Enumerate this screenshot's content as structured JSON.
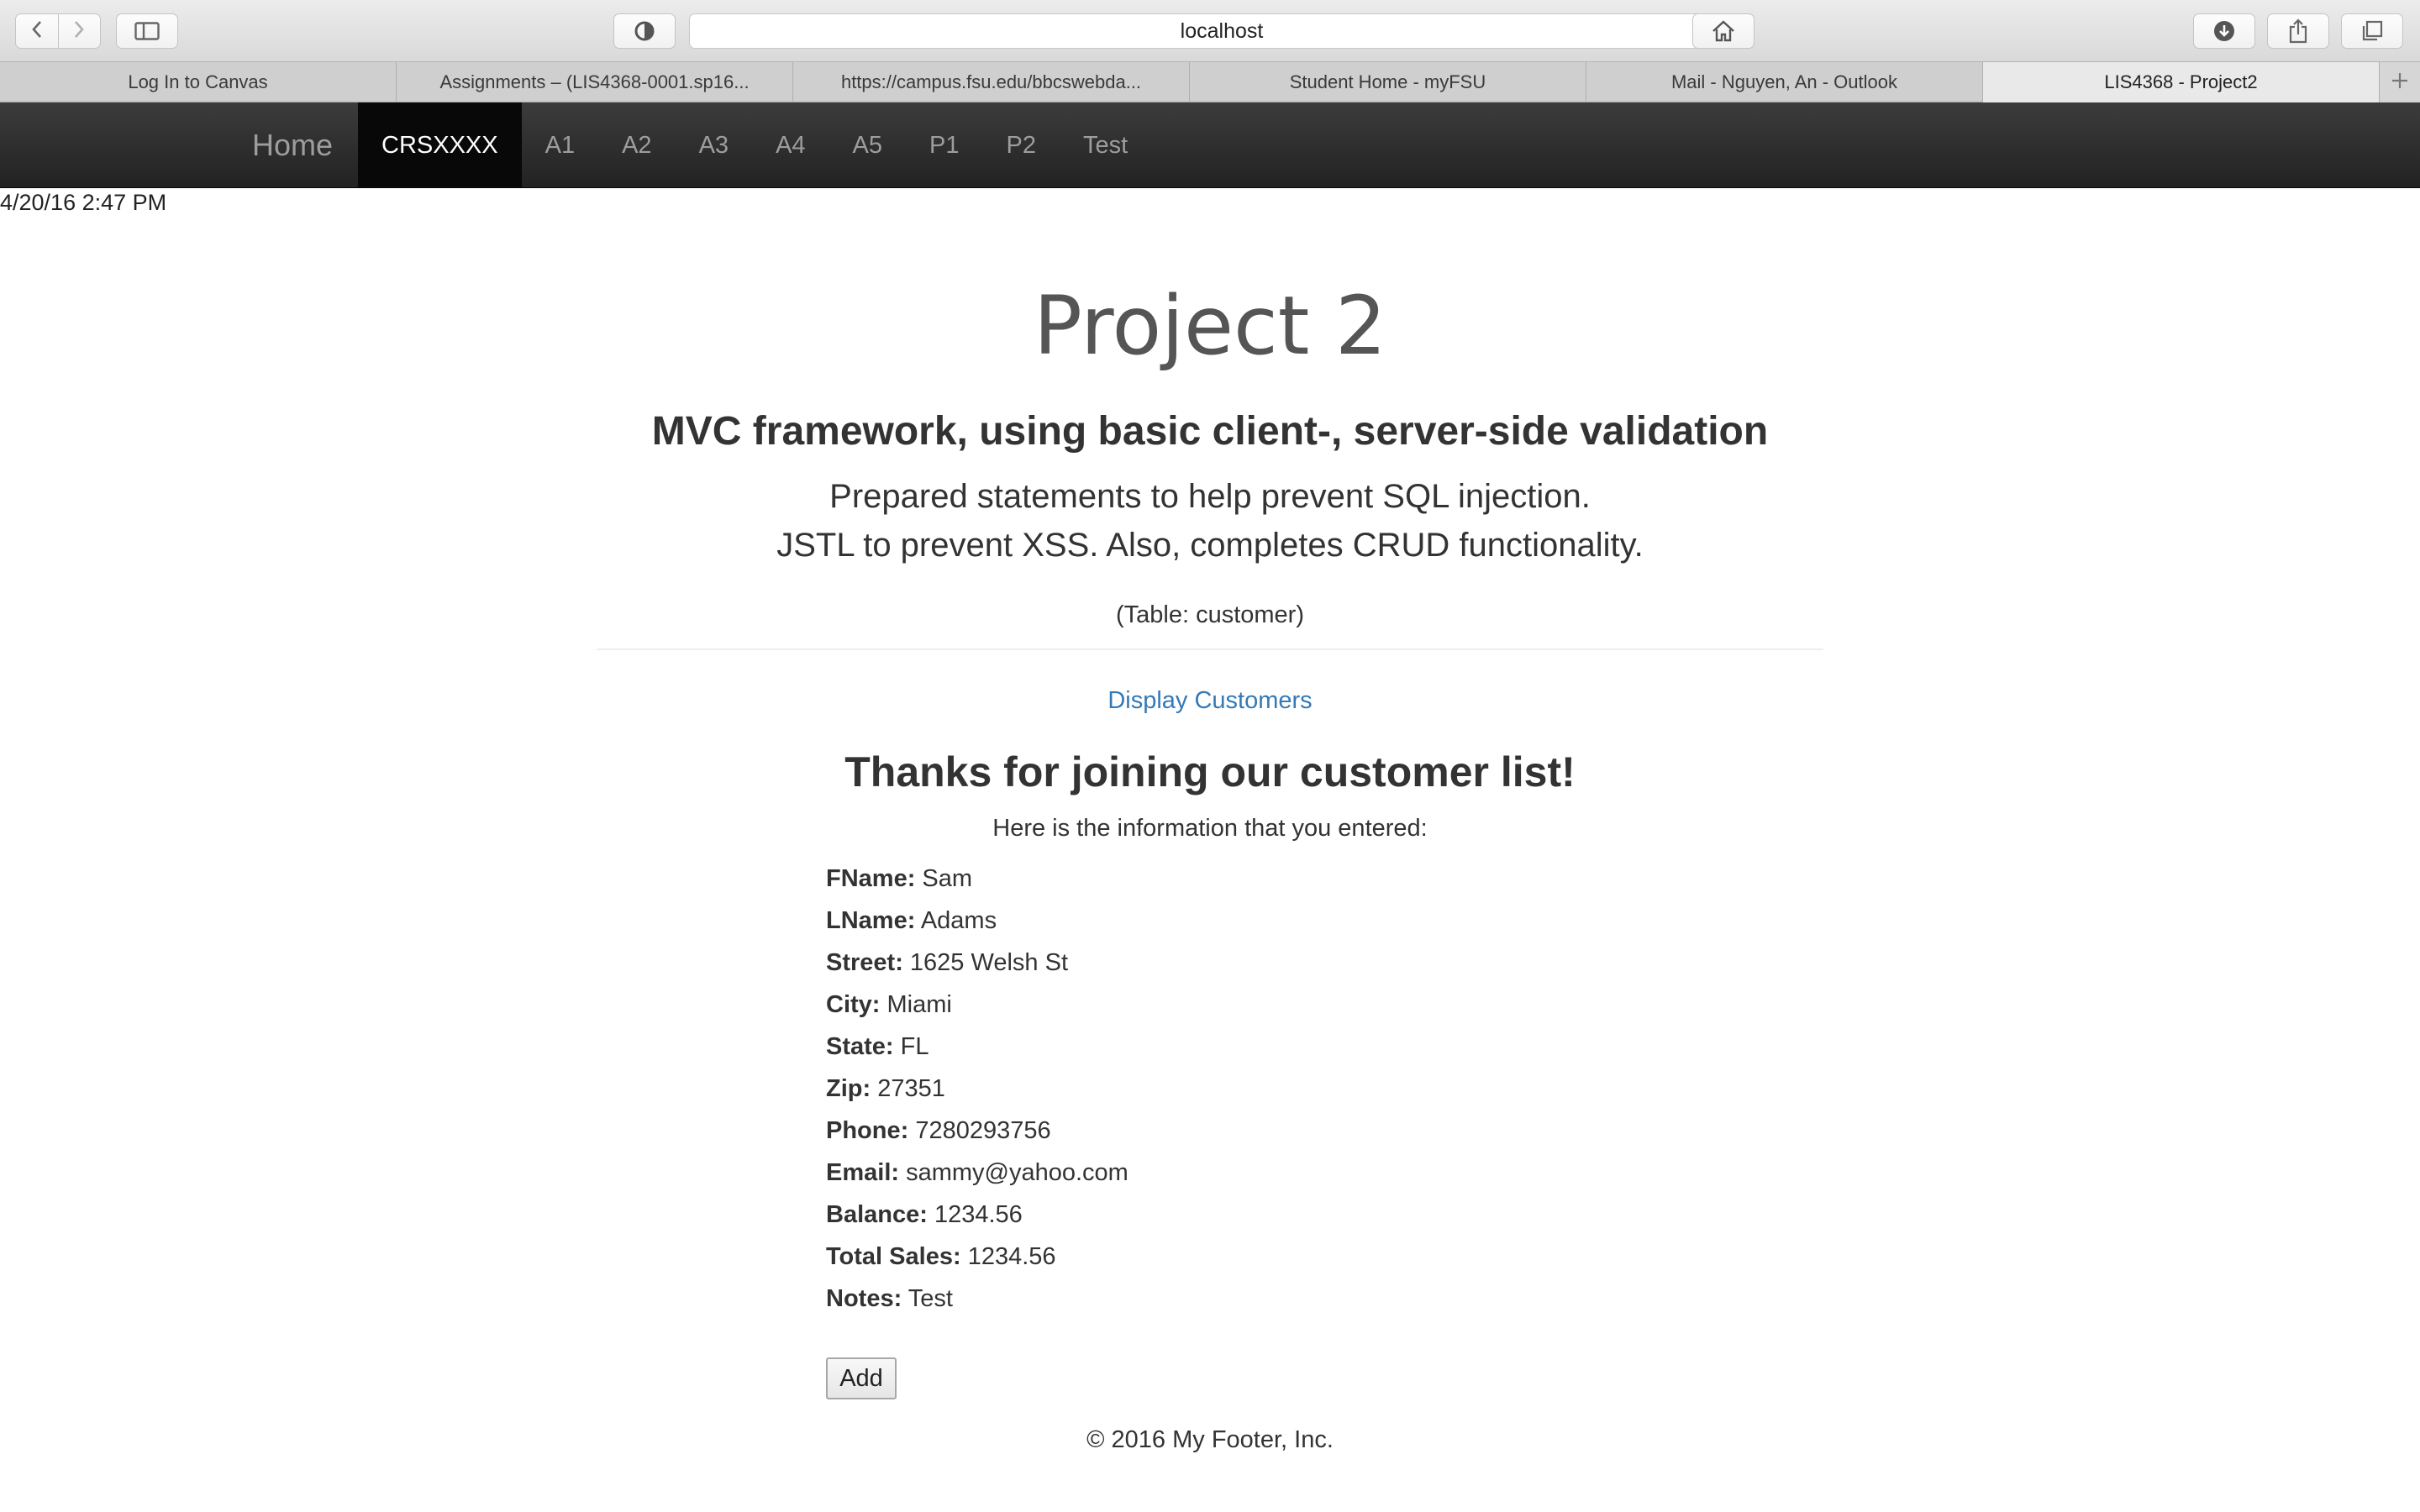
{
  "browser": {
    "url": "localhost",
    "tabs": [
      {
        "label": "Log In to Canvas"
      },
      {
        "label": "Assignments – (LIS4368-0001.sp16..."
      },
      {
        "label": "https://campus.fsu.edu/bbcswebda..."
      },
      {
        "label": "Student Home - myFSU"
      },
      {
        "label": "Mail - Nguyen, An - Outlook"
      },
      {
        "label": "LIS4368 - Project2",
        "active": true
      }
    ],
    "icons": [
      "back-icon",
      "forward-icon",
      "sidebar-icon",
      "privacy-icon",
      "reload-icon",
      "home-icon",
      "downloads-icon",
      "share-icon",
      "tabs-overview-icon",
      "new-tab-icon"
    ]
  },
  "navbar": {
    "brand": "Home",
    "items": [
      {
        "label": "CRSXXXX",
        "active": true
      },
      {
        "label": "A1"
      },
      {
        "label": "A2"
      },
      {
        "label": "A3"
      },
      {
        "label": "A4"
      },
      {
        "label": "A5"
      },
      {
        "label": "P1"
      },
      {
        "label": "P2"
      },
      {
        "label": "Test"
      }
    ]
  },
  "page": {
    "timestamp": "4/20/16 2:47 PM",
    "title": "Project 2",
    "subtitle": "MVC framework, using basic client-, server-side validation",
    "lead_line1": "Prepared statements to help prevent SQL injection.",
    "lead_line2": "JSTL to prevent XSS. Also, completes CRUD functionality.",
    "table_note": "(Table: customer)",
    "display_link": "Display Customers",
    "thanks": "Thanks for joining our customer list!",
    "entered_note": "Here is the information that you entered:",
    "fields": [
      {
        "label": "FName:",
        "value": "Sam"
      },
      {
        "label": "LName:",
        "value": "Adams"
      },
      {
        "label": "Street:",
        "value": "1625 Welsh St"
      },
      {
        "label": "City:",
        "value": "Miami"
      },
      {
        "label": "State:",
        "value": "FL"
      },
      {
        "label": "Zip:",
        "value": "27351"
      },
      {
        "label": "Phone:",
        "value": "7280293756"
      },
      {
        "label": "Email:",
        "value": "sammy@yahoo.com"
      },
      {
        "label": "Balance:",
        "value": "1234.56"
      },
      {
        "label": "Total Sales:",
        "value": "1234.56"
      },
      {
        "label": "Notes:",
        "value": "Test"
      }
    ],
    "add_button": "Add",
    "footer": "© 2016 My Footer, Inc."
  },
  "colors": {
    "navbar_bg": "#222222",
    "navbar_active_bg": "#080808",
    "link": "#337ab7",
    "title": "#555555"
  }
}
